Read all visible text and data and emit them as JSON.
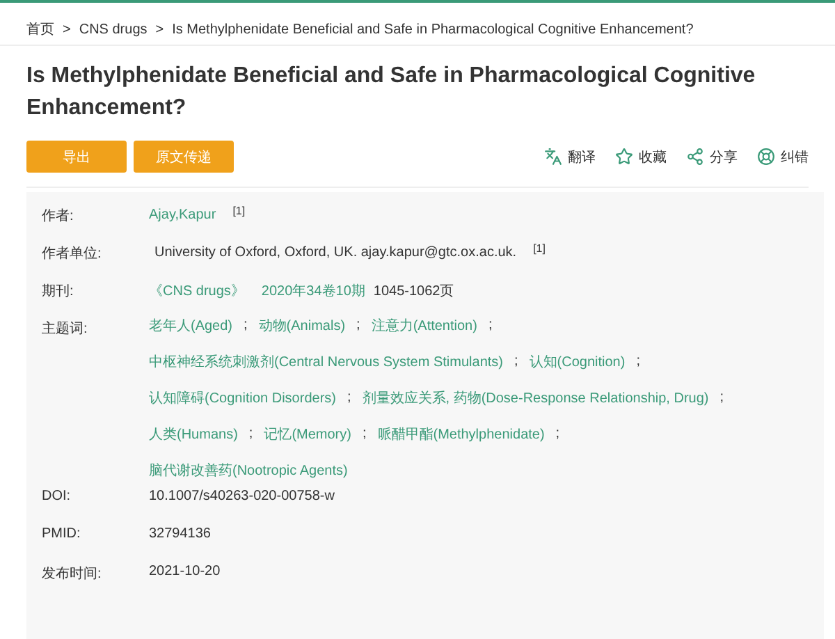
{
  "breadcrumb": {
    "separator": ">",
    "items": [
      "首页",
      "CNS drugs",
      "Is Methylphenidate Beneficial and Safe in Pharmacological Cognitive Enhancement?"
    ]
  },
  "title": "Is Methylphenidate Beneficial and Safe in Pharmacological Cognitive Enhancement?",
  "buttons": [
    "导出",
    "原文传递"
  ],
  "actions": [
    {
      "kind": "translate",
      "label": "翻译"
    },
    {
      "kind": "favorite",
      "label": "收藏"
    },
    {
      "kind": "share",
      "label": "分享"
    },
    {
      "kind": "correct",
      "label": "纠错"
    }
  ],
  "details": {
    "author": {
      "label": "作者:",
      "name": "Ajay,Kapur",
      "ref": "[1]"
    },
    "affiliation": {
      "label": "作者单位:",
      "text": "University of Oxford, Oxford, UK. ajay.kapur@gtc.ox.ac.uk.",
      "ref": "[1]"
    },
    "journal": {
      "label": "期刊:",
      "name": "《CNS drugs》",
      "issue": "2020年34卷10期",
      "pages": "1045-1062页"
    },
    "subjects": {
      "label": "主题词:",
      "separator": ";",
      "lines": [
        [
          "老年人(Aged)",
          "动物(Animals)",
          "注意力(Attention)"
        ],
        [
          "中枢神经系统刺激剂(Central Nervous System Stimulants)",
          "认知(Cognition)"
        ],
        [
          "认知障碍(Cognition Disorders)",
          "剂量效应关系, 药物(Dose-Response Relationship, Drug)"
        ],
        [
          "人类(Humans)",
          "记忆(Memory)",
          "哌醋甲酯(Methylphenidate)"
        ],
        [
          "脑代谢改善药(Nootropic Agents)"
        ]
      ]
    },
    "fields": [
      {
        "label": "DOI:",
        "value": "10.1007/s40263-020-00758-w"
      },
      {
        "label": "PMID:",
        "value": "32794136"
      },
      {
        "label": "发布时间:",
        "value": "2021-10-20"
      }
    ]
  }
}
